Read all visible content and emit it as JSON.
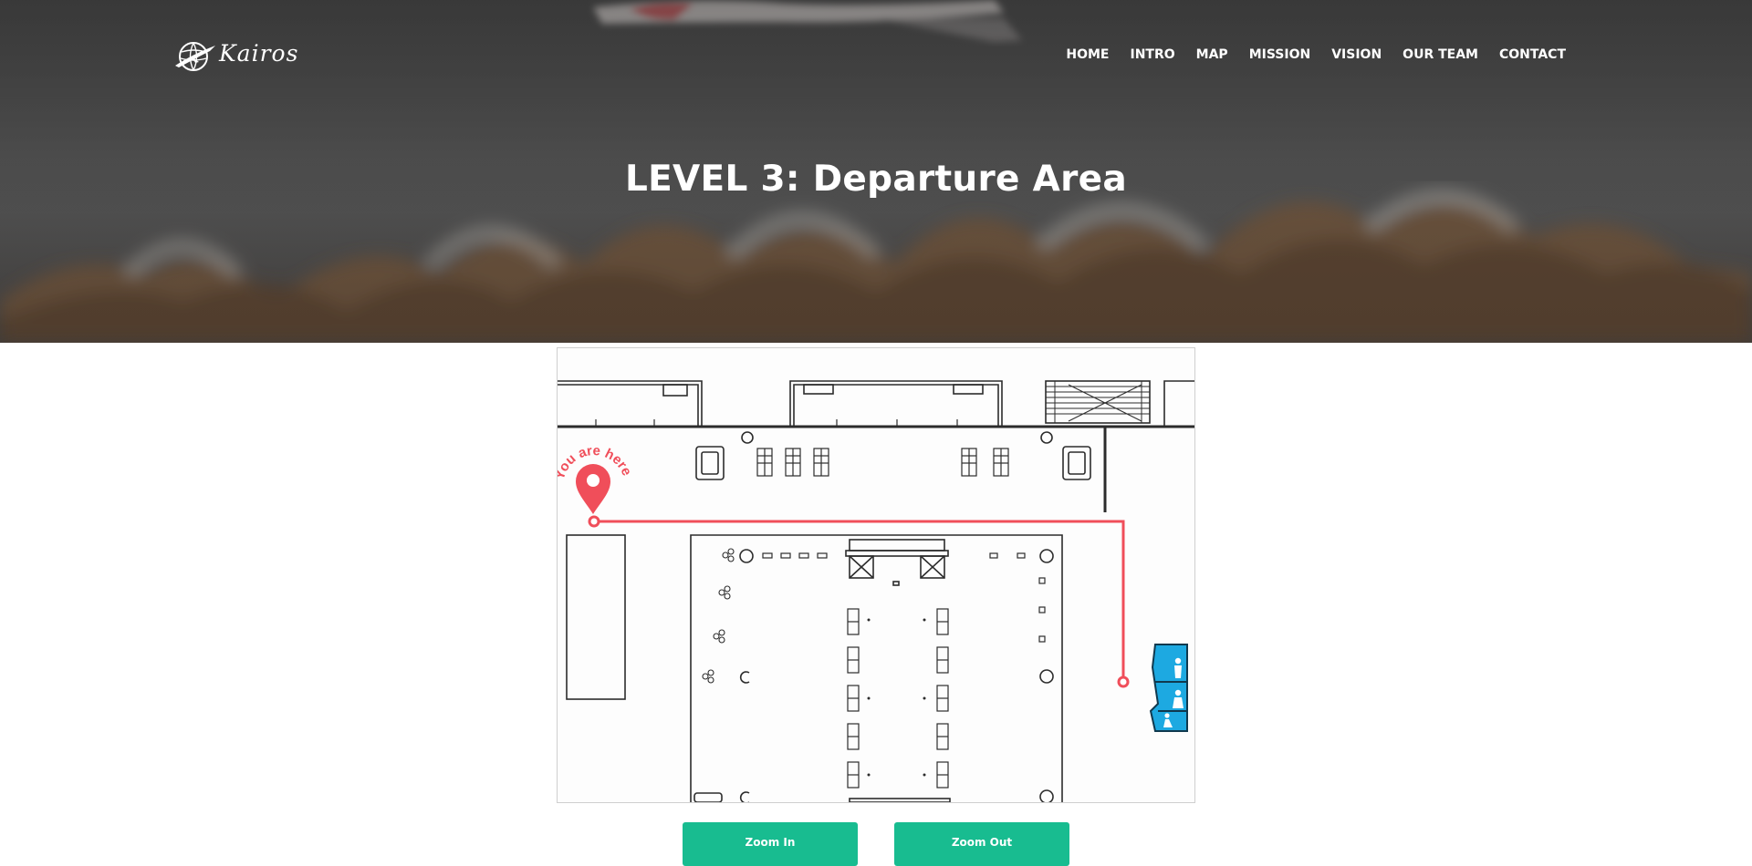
{
  "brand": {
    "name": "Kairos",
    "logo_icon": "globe-airplane-icon"
  },
  "nav": {
    "items": [
      {
        "label": "HOME"
      },
      {
        "label": "INTRO"
      },
      {
        "label": "MAP"
      },
      {
        "label": "MISSION"
      },
      {
        "label": "VISION"
      },
      {
        "label": "OUR TEAM"
      },
      {
        "label": "CONTACT"
      }
    ]
  },
  "hero": {
    "title": "LEVEL 3: Departure Area"
  },
  "map": {
    "marker_label": "You are here",
    "marker_icon": "location-pin-icon",
    "restroom_icon": "restroom-icon",
    "route_color": "#f04e5a",
    "restroom_color": "#1da9e1"
  },
  "controls": {
    "zoom_in_label": "Zoom In",
    "zoom_out_label": "Zoom Out",
    "accent_color": "#18bc90"
  }
}
